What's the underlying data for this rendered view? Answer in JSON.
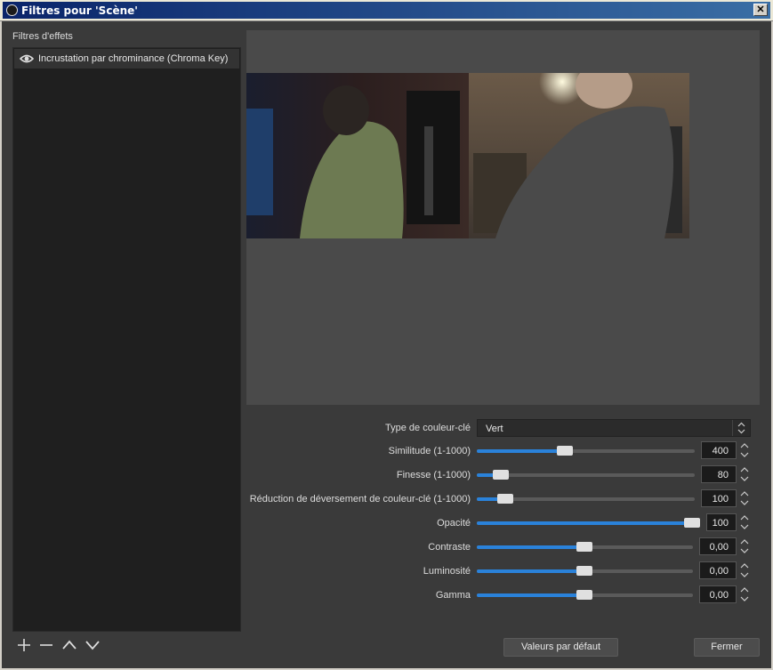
{
  "window": {
    "title": "Filtres pour 'Scène'",
    "close_glyph": "✕"
  },
  "filters": {
    "section_label": "Filtres d'effets",
    "items": [
      {
        "label": "Incrustation par chrominance (Chroma Key)",
        "visible_icon": "eye-icon"
      }
    ]
  },
  "toolbar": {
    "icons": [
      "add-icon",
      "remove-icon",
      "move-up-icon",
      "move-down-icon"
    ]
  },
  "properties": {
    "key_color_type": {
      "label": "Type de couleur-clé",
      "value": "Vert"
    },
    "similarity": {
      "label": "Similitude (1-1000)",
      "value": "400",
      "fraction": 0.4
    },
    "smoothness": {
      "label": "Finesse (1-1000)",
      "value": "80",
      "fraction": 0.08
    },
    "spill": {
      "label": "Réduction de déversement de couleur-clé (1-1000)",
      "value": "100",
      "fraction": 0.1
    },
    "opacity": {
      "label": "Opacité",
      "value": "100",
      "fraction": 1.0
    },
    "contrast": {
      "label": "Contraste",
      "value": "0,00",
      "fraction": 0.5
    },
    "brightness": {
      "label": "Luminosité",
      "value": "0,00",
      "fraction": 0.5
    },
    "gamma": {
      "label": "Gamma",
      "value": "0,00",
      "fraction": 0.5
    }
  },
  "buttons": {
    "defaults": "Valeurs par défaut",
    "close": "Fermer"
  },
  "colors": {
    "accent": "#2a82da",
    "list_bg": "#1f1f1f",
    "window_bg": "#3a3a3a"
  }
}
